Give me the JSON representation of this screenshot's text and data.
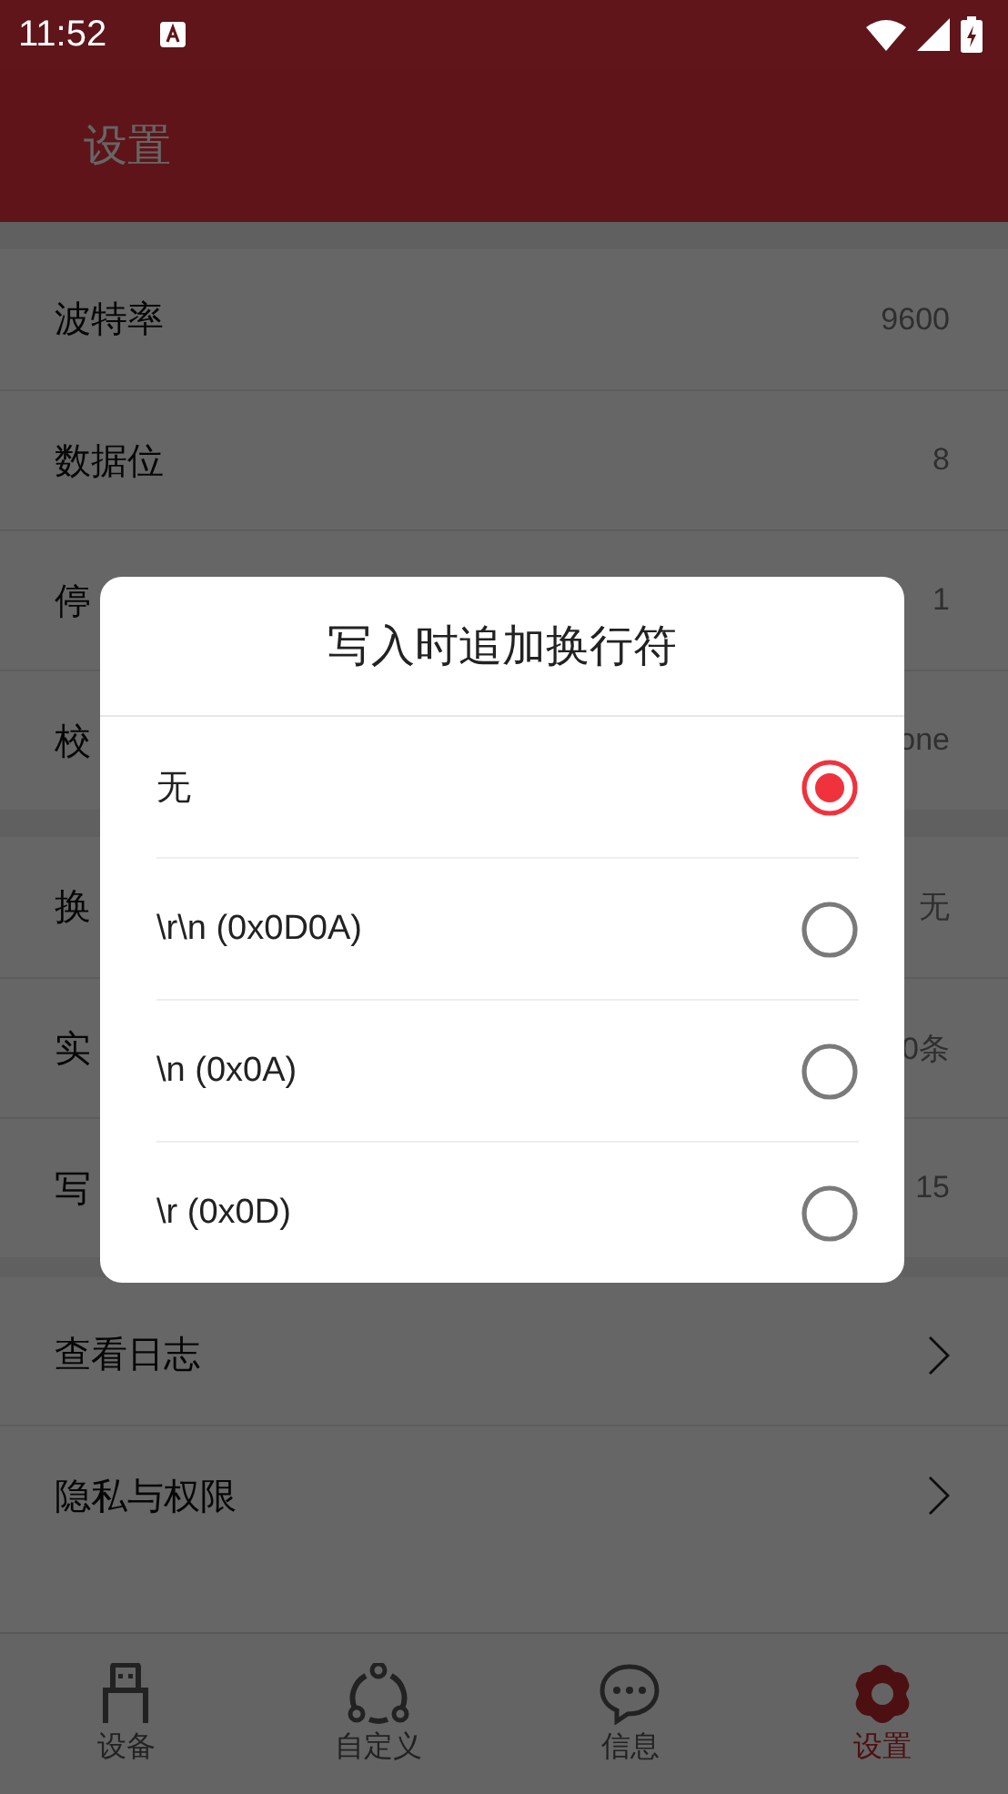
{
  "status_bar": {
    "time": "11:52"
  },
  "app_bar": {
    "title": "设置"
  },
  "sections": [
    {
      "rows": [
        {
          "kind": "value",
          "label": "波特率",
          "value": "9600"
        },
        {
          "kind": "value",
          "label": "数据位",
          "value": "8"
        },
        {
          "kind": "value",
          "label": "停",
          "value": "1"
        },
        {
          "kind": "value",
          "label": "校",
          "value": "one"
        }
      ]
    },
    {
      "rows": [
        {
          "kind": "value",
          "label": "换",
          "value": "无"
        },
        {
          "kind": "value",
          "label": "实",
          "value": "0条"
        },
        {
          "kind": "value",
          "label": "写",
          "value": "15"
        }
      ]
    },
    {
      "rows": [
        {
          "kind": "link",
          "label": "查看日志"
        },
        {
          "kind": "link",
          "label": "隐私与权限"
        }
      ]
    }
  ],
  "bottom_nav": [
    {
      "label": "设备",
      "selected": false
    },
    {
      "label": "自定义",
      "selected": false
    },
    {
      "label": "信息",
      "selected": false
    },
    {
      "label": "设置",
      "selected": true
    }
  ],
  "dialog": {
    "title": "写入时追加换行符",
    "options": [
      {
        "label": "无",
        "selected": true
      },
      {
        "label": "\\r\\n (0x0D0A)",
        "selected": false
      },
      {
        "label": "\\n (0x0A)",
        "selected": false
      },
      {
        "label": "\\r (0x0D)",
        "selected": false
      }
    ]
  }
}
